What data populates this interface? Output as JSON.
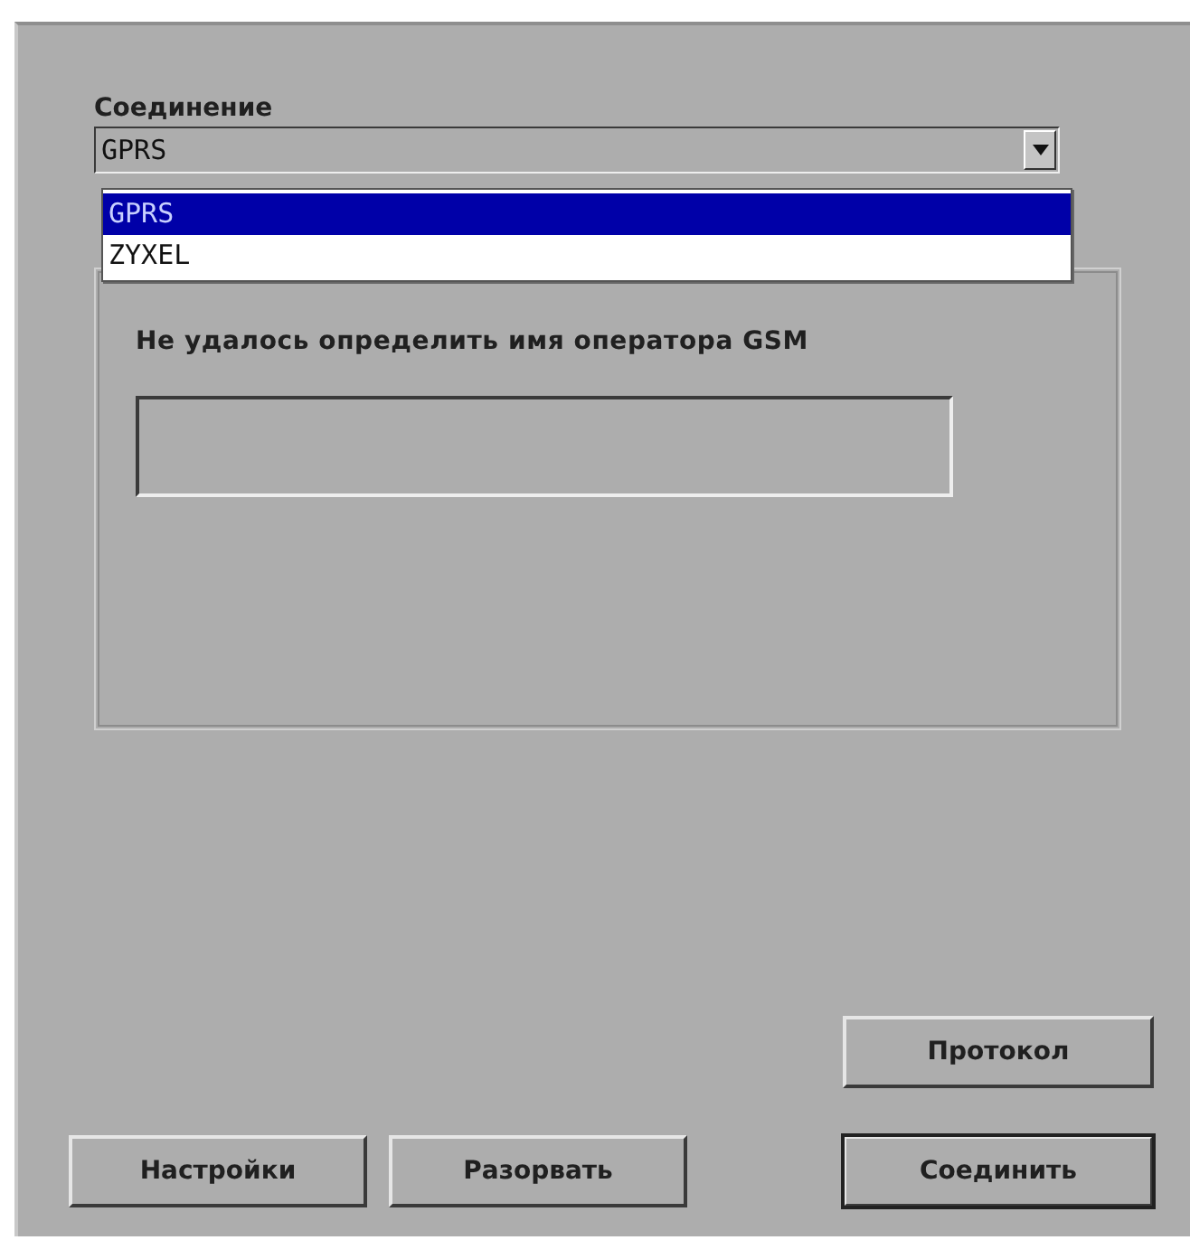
{
  "connection": {
    "label": "Соединение",
    "value": "GPRS",
    "options": [
      {
        "label": "GPRS",
        "selected": true
      },
      {
        "label": "ZYXEL",
        "selected": false
      }
    ]
  },
  "status": {
    "message": "Не удалось определить имя оператора GSM"
  },
  "log_button": {
    "label": "Протокол"
  },
  "buttons": [
    {
      "label": "Настройки",
      "default": false
    },
    {
      "label": "Разорвать",
      "default": false
    },
    {
      "label": "Соединить",
      "default": true
    }
  ]
}
